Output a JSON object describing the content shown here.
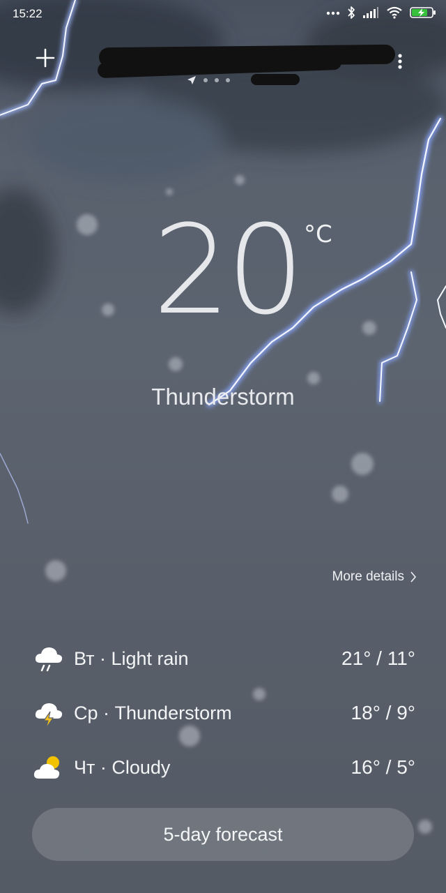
{
  "status_bar": {
    "time": "15:22",
    "icons": [
      "more-dots-icon",
      "bluetooth-icon",
      "signal-icon",
      "wifi-icon",
      "battery-charging-icon"
    ]
  },
  "header": {
    "add_icon": "plus-icon",
    "city_name": "",
    "menu_icon": "more-vert-icon",
    "page_indicator": {
      "total": 4,
      "current": 0,
      "current_icon": "location-arrow-icon"
    }
  },
  "current": {
    "temperature": "20",
    "unit": "°C",
    "condition": "Thunderstorm"
  },
  "more_details": {
    "label": "More details",
    "icon": "chevron-right-icon"
  },
  "forecast": [
    {
      "day": "Вт",
      "description": "Light rain",
      "label": "Вт · Light rain",
      "temps": "21° / 11°",
      "icon": "rain-cloud-icon"
    },
    {
      "day": "Ср",
      "description": "Thunderstorm",
      "label": "Ср · Thunderstorm",
      "temps": "18° / 9°",
      "icon": "thunder-cloud-icon"
    },
    {
      "day": "Чт",
      "description": "Cloudy",
      "label": "Чт · Cloudy",
      "temps": "16° / 5°",
      "icon": "partly-cloudy-icon"
    }
  ],
  "five_day_button": {
    "label": "5-day forecast"
  },
  "colors": {
    "background": "#5a616c",
    "lightning": "#cfe0ff",
    "sun": "#f2c200",
    "bolt": "#f4c21a"
  }
}
